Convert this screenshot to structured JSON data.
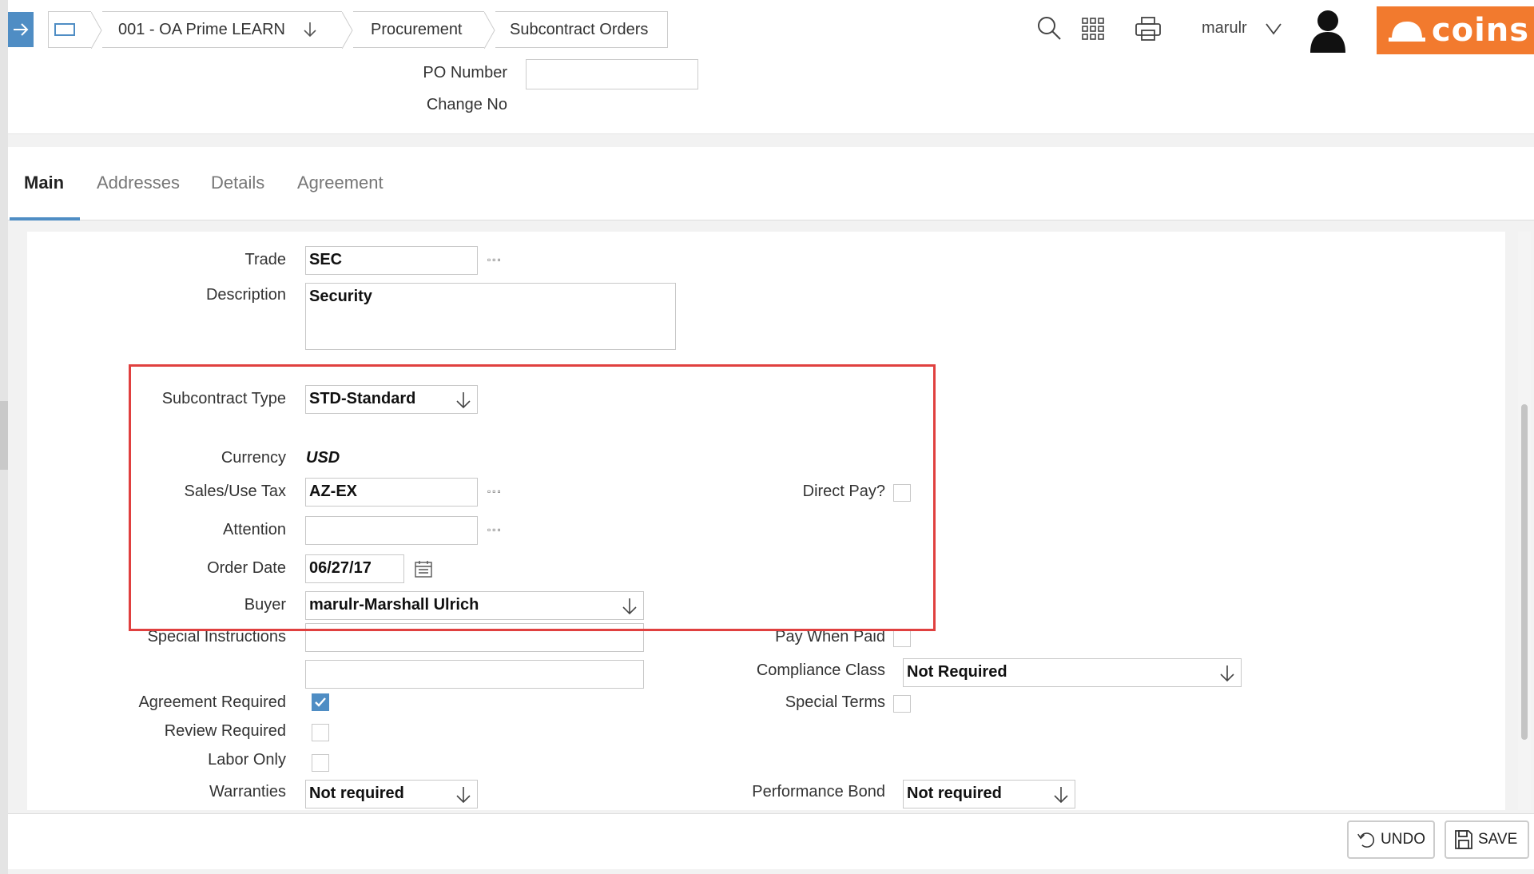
{
  "breadcrumb": {
    "company": "001 - OA Prime LEARN",
    "module": "Procurement",
    "page": "Subcontract Orders"
  },
  "header": {
    "po_number_label": "PO Number",
    "po_number_value": "",
    "change_no_label": "Change No",
    "user": "marulr",
    "logo_text": "coins"
  },
  "tabs": [
    {
      "label": "Main"
    },
    {
      "label": "Addresses"
    },
    {
      "label": "Details"
    },
    {
      "label": "Agreement"
    }
  ],
  "form": {
    "trade": {
      "label": "Trade",
      "value": "SEC"
    },
    "description": {
      "label": "Description",
      "value": "Security"
    },
    "subcontract_type": {
      "label": "Subcontract Type",
      "value": "STD-Standard"
    },
    "currency": {
      "label": "Currency",
      "value": "USD"
    },
    "sales_tax": {
      "label": "Sales/Use Tax",
      "value": "AZ-EX"
    },
    "direct_pay": {
      "label": "Direct Pay?",
      "checked": false
    },
    "attention": {
      "label": "Attention",
      "value": ""
    },
    "order_date": {
      "label": "Order Date",
      "value": "06/27/17"
    },
    "buyer": {
      "label": "Buyer",
      "value": "marulr-Marshall Ulrich"
    },
    "special_instructions": {
      "label": "Special Instructions",
      "value1": "",
      "value2": ""
    },
    "pay_when_paid": {
      "label": "Pay When Paid",
      "checked": false
    },
    "compliance_class": {
      "label": "Compliance Class",
      "value": "Not Required"
    },
    "agreement_required": {
      "label": "Agreement Required",
      "checked": true
    },
    "special_terms": {
      "label": "Special Terms",
      "checked": false
    },
    "review_required": {
      "label": "Review Required",
      "checked": false
    },
    "labor_only": {
      "label": "Labor Only",
      "checked": false
    },
    "warranties": {
      "label": "Warranties",
      "value": "Not required"
    },
    "performance_bond": {
      "label": "Performance Bond",
      "value": "Not required"
    }
  },
  "footer": {
    "undo_label": "UNDO",
    "save_label": "SAVE"
  },
  "colors": {
    "accent": "#4f8dc4",
    "brand": "#f27a2e",
    "highlight": "#e0403f"
  }
}
